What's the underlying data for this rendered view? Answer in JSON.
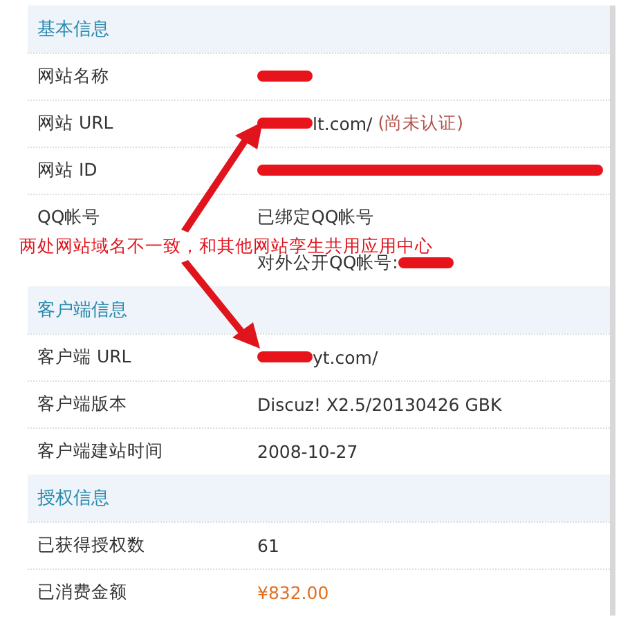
{
  "sections": [
    {
      "title": "基本信息",
      "rows": [
        {
          "label": "网站名称",
          "lines": [
            [
              {
                "kind": "redacted"
              }
            ]
          ]
        },
        {
          "label": "网站 URL",
          "lines": [
            [
              {
                "kind": "redacted"
              },
              {
                "kind": "text",
                "text": "lt.com/"
              },
              {
                "kind": "status",
                "text": "(尚未认证)"
              }
            ]
          ]
        },
        {
          "label": "网站 ID",
          "lines": [
            [
              {
                "kind": "redacted-long"
              }
            ]
          ]
        },
        {
          "label": "QQ帐号",
          "lines": [
            [
              {
                "kind": "text",
                "text": "已绑定QQ帐号"
              }
            ],
            [
              {
                "kind": "text",
                "text": "对外公开QQ帐号:"
              },
              {
                "kind": "redacted"
              }
            ]
          ]
        }
      ]
    },
    {
      "title": "客户端信息",
      "rows": [
        {
          "label": "客户端 URL",
          "lines": [
            [
              {
                "kind": "redacted"
              },
              {
                "kind": "text",
                "text": "yt.com/"
              }
            ]
          ]
        },
        {
          "label": "客户端版本",
          "lines": [
            [
              {
                "kind": "text",
                "text": "Discuz! X2.5/20130426 GBK"
              }
            ]
          ]
        },
        {
          "label": "客户端建站时间",
          "lines": [
            [
              {
                "kind": "text",
                "text": "2008-10-27"
              }
            ]
          ]
        }
      ]
    },
    {
      "title": "授权信息",
      "rows": [
        {
          "label": "已获得授权数",
          "lines": [
            [
              {
                "kind": "text",
                "text": "61"
              }
            ]
          ]
        },
        {
          "label": "已消费金额",
          "lines": [
            [
              {
                "kind": "amount",
                "text": "¥832.00"
              }
            ]
          ]
        }
      ]
    }
  ],
  "annotation": {
    "text": "两处网站域名不一致，和其他网站孪生共用应用中心"
  }
}
